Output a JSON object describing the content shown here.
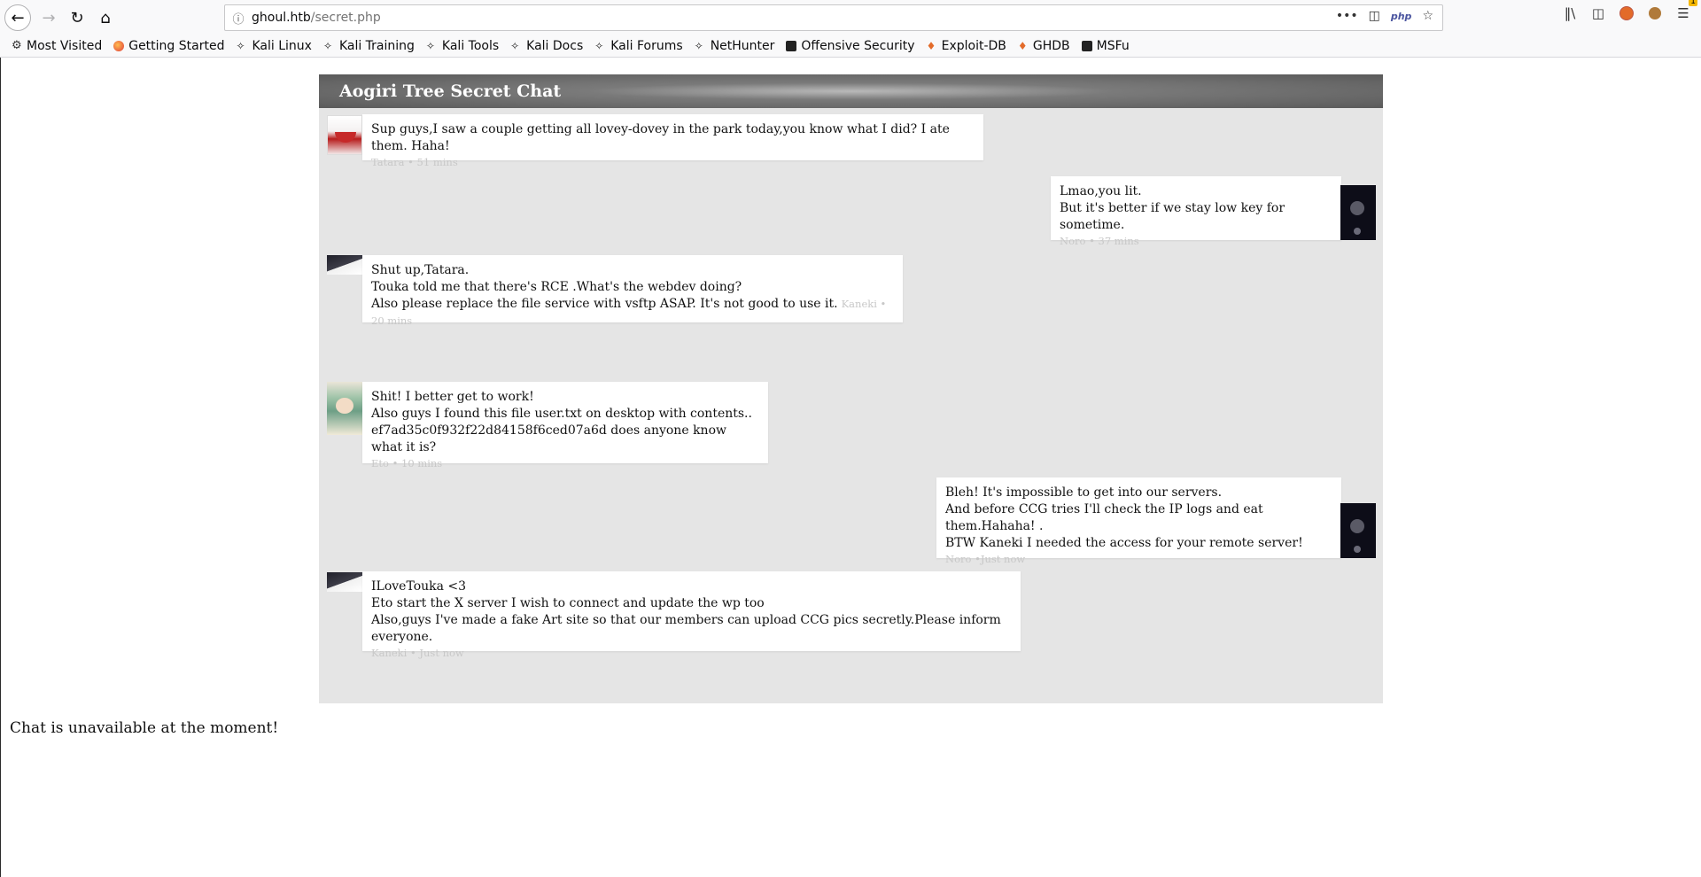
{
  "browser": {
    "url_host": "ghoul.htb",
    "url_path": "/secret.php",
    "url_badge": "php",
    "bookmarks": [
      {
        "label": "Most Visited",
        "icon": "gear-icon"
      },
      {
        "label": "Getting Started",
        "icon": "firefox-icon"
      },
      {
        "label": "Kali Linux",
        "icon": "kali-icon"
      },
      {
        "label": "Kali Training",
        "icon": "kali-icon"
      },
      {
        "label": "Kali Tools",
        "icon": "kali-icon"
      },
      {
        "label": "Kali Docs",
        "icon": "kali-icon"
      },
      {
        "label": "Kali Forums",
        "icon": "kali-icon"
      },
      {
        "label": "NetHunter",
        "icon": "kali-icon"
      },
      {
        "label": "Offensive Security",
        "icon": "offsec-icon"
      },
      {
        "label": "Exploit-DB",
        "icon": "exploitdb-icon"
      },
      {
        "label": "GHDB",
        "icon": "exploitdb-icon"
      },
      {
        "label": "MSFu",
        "icon": "offsec-icon"
      }
    ],
    "menu_badge": "1"
  },
  "chat": {
    "title": "Aogiri Tree Secret Chat",
    "messages": [
      {
        "lines": [
          "Sup guys,I saw a couple getting all lovey-dovey in the park today,you know what I did? I ate them. Haha!"
        ],
        "author": "Tatara",
        "time": "51 mins",
        "meta": "Tatara • 51 mins"
      },
      {
        "lines": [
          "Lmao,you lit.",
          "But it's better if we stay low key for sometime."
        ],
        "author": "Noro",
        "time": "37 mins",
        "meta": "Noro • 37 mins"
      },
      {
        "lines": [
          "Shut up,Tatara.",
          "Touka told me that there's RCE .What's the webdev doing?",
          "Also please replace the file service with vsftp ASAP. It's not good to use it."
        ],
        "author": "Kaneki",
        "time": "20 mins",
        "meta": "Kaneki • 20 mins"
      },
      {
        "lines": [
          "Shit! I better get to work!",
          "Also guys I found this file user.txt on desktop with contents..",
          "ef7ad35c0f932f22d84158f6ced07a6d does anyone know what it is?"
        ],
        "author": "Eto",
        "time": "10 mins",
        "meta": "Eto • 10 mins"
      },
      {
        "lines": [
          "Bleh! It's impossible to get into our servers.",
          "And before CCG tries I'll check the IP logs and eat them.Hahaha! .",
          "BTW Kaneki I needed the access for your remote server!"
        ],
        "author": "Noro",
        "time": "Just now",
        "meta": "Noro •Just now"
      },
      {
        "lines": [
          "ILoveTouka <3",
          "Eto start the X server I wish to connect and update the wp too",
          "Also,guys I've made a fake Art site so that our members can upload CCG pics secretly.Please inform everyone."
        ],
        "author": "Kaneki",
        "time": "Just now",
        "meta": "Kaneki • Just now"
      }
    ]
  },
  "footer": {
    "status_text": "Chat is unavailable at the moment!"
  }
}
